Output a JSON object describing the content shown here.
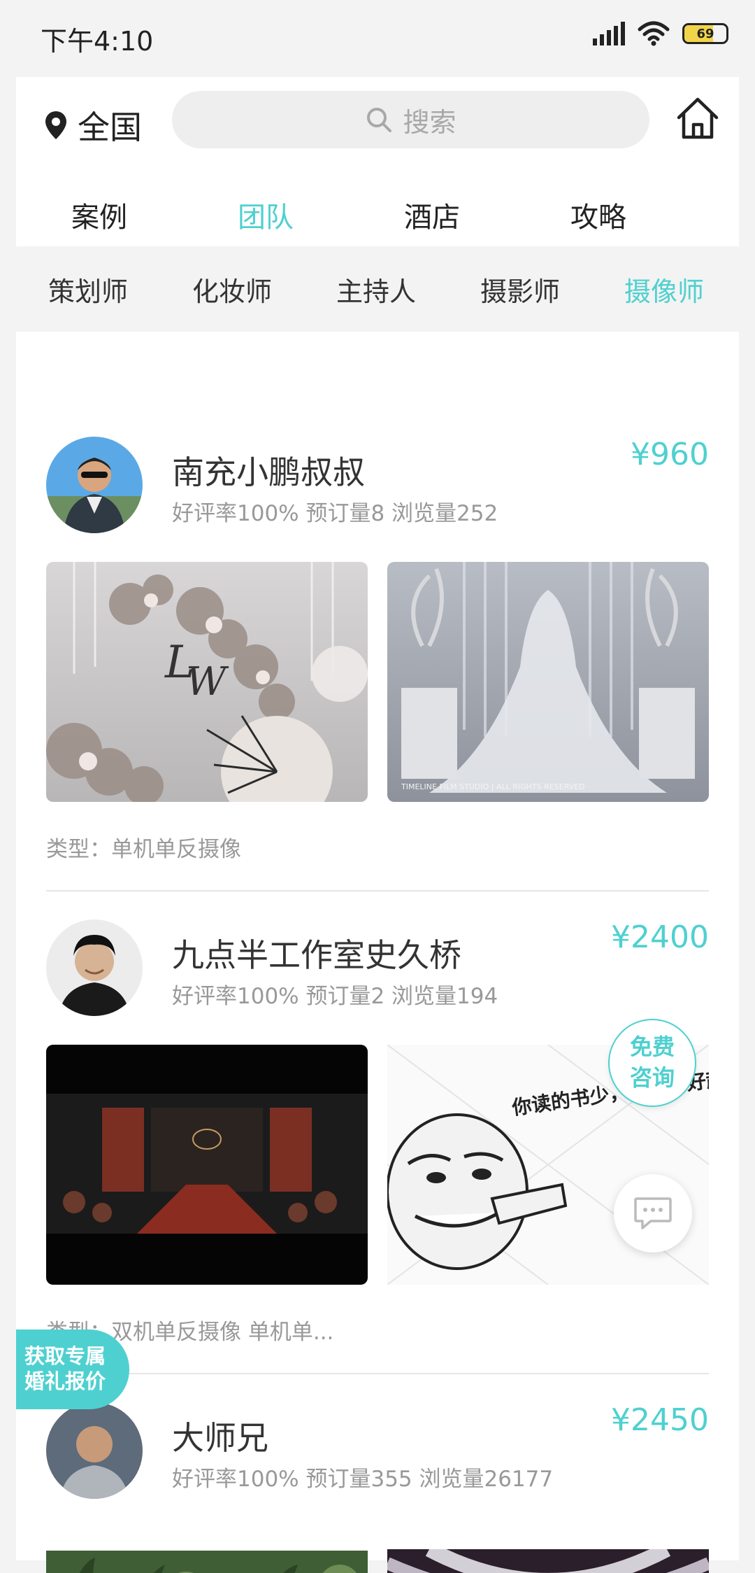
{
  "status": {
    "time": "下午4:10",
    "battery": "69"
  },
  "header": {
    "location": "全国",
    "search_placeholder": "搜索"
  },
  "tabs": [
    {
      "label": "案例",
      "active": false
    },
    {
      "label": "团队",
      "active": true
    },
    {
      "label": "酒店",
      "active": false
    },
    {
      "label": "攻略",
      "active": false
    }
  ],
  "subtabs": [
    {
      "label": "策划师",
      "active": false
    },
    {
      "label": "化妆师",
      "active": false
    },
    {
      "label": "主持人",
      "active": false
    },
    {
      "label": "摄影师",
      "active": false
    },
    {
      "label": "摄像师",
      "active": true
    }
  ],
  "teams": [
    {
      "name": "南充小鹏叔叔",
      "stats": "好评率100% 预订量8 浏览量252",
      "price": "¥960",
      "type": "类型：单机单反摄像"
    },
    {
      "name": "九点半工作室史久桥",
      "stats": "好评率100% 预订量2 浏览量194",
      "price": "¥2400",
      "type": "类型：双机单反摄像 单机单..."
    },
    {
      "name": "大师兄",
      "stats": "好评率100% 预订量355 浏览量26177",
      "price": "¥2450",
      "type": ""
    }
  ],
  "photos": {
    "watermark_film": "TIMELINE FILM STUDIO  |  ALL RIGHTS RESERVED",
    "meme_caption": "你读的书少，所以看好起不好"
  },
  "floating": {
    "free_consult": "免费咨询",
    "free_line1": "免费",
    "free_line2": "咨询",
    "quote_line1": "获取专属",
    "quote_line2": "婚礼报价"
  },
  "colors": {
    "accent": "#4fd0d0",
    "text": "#333333",
    "muted": "#999999"
  }
}
